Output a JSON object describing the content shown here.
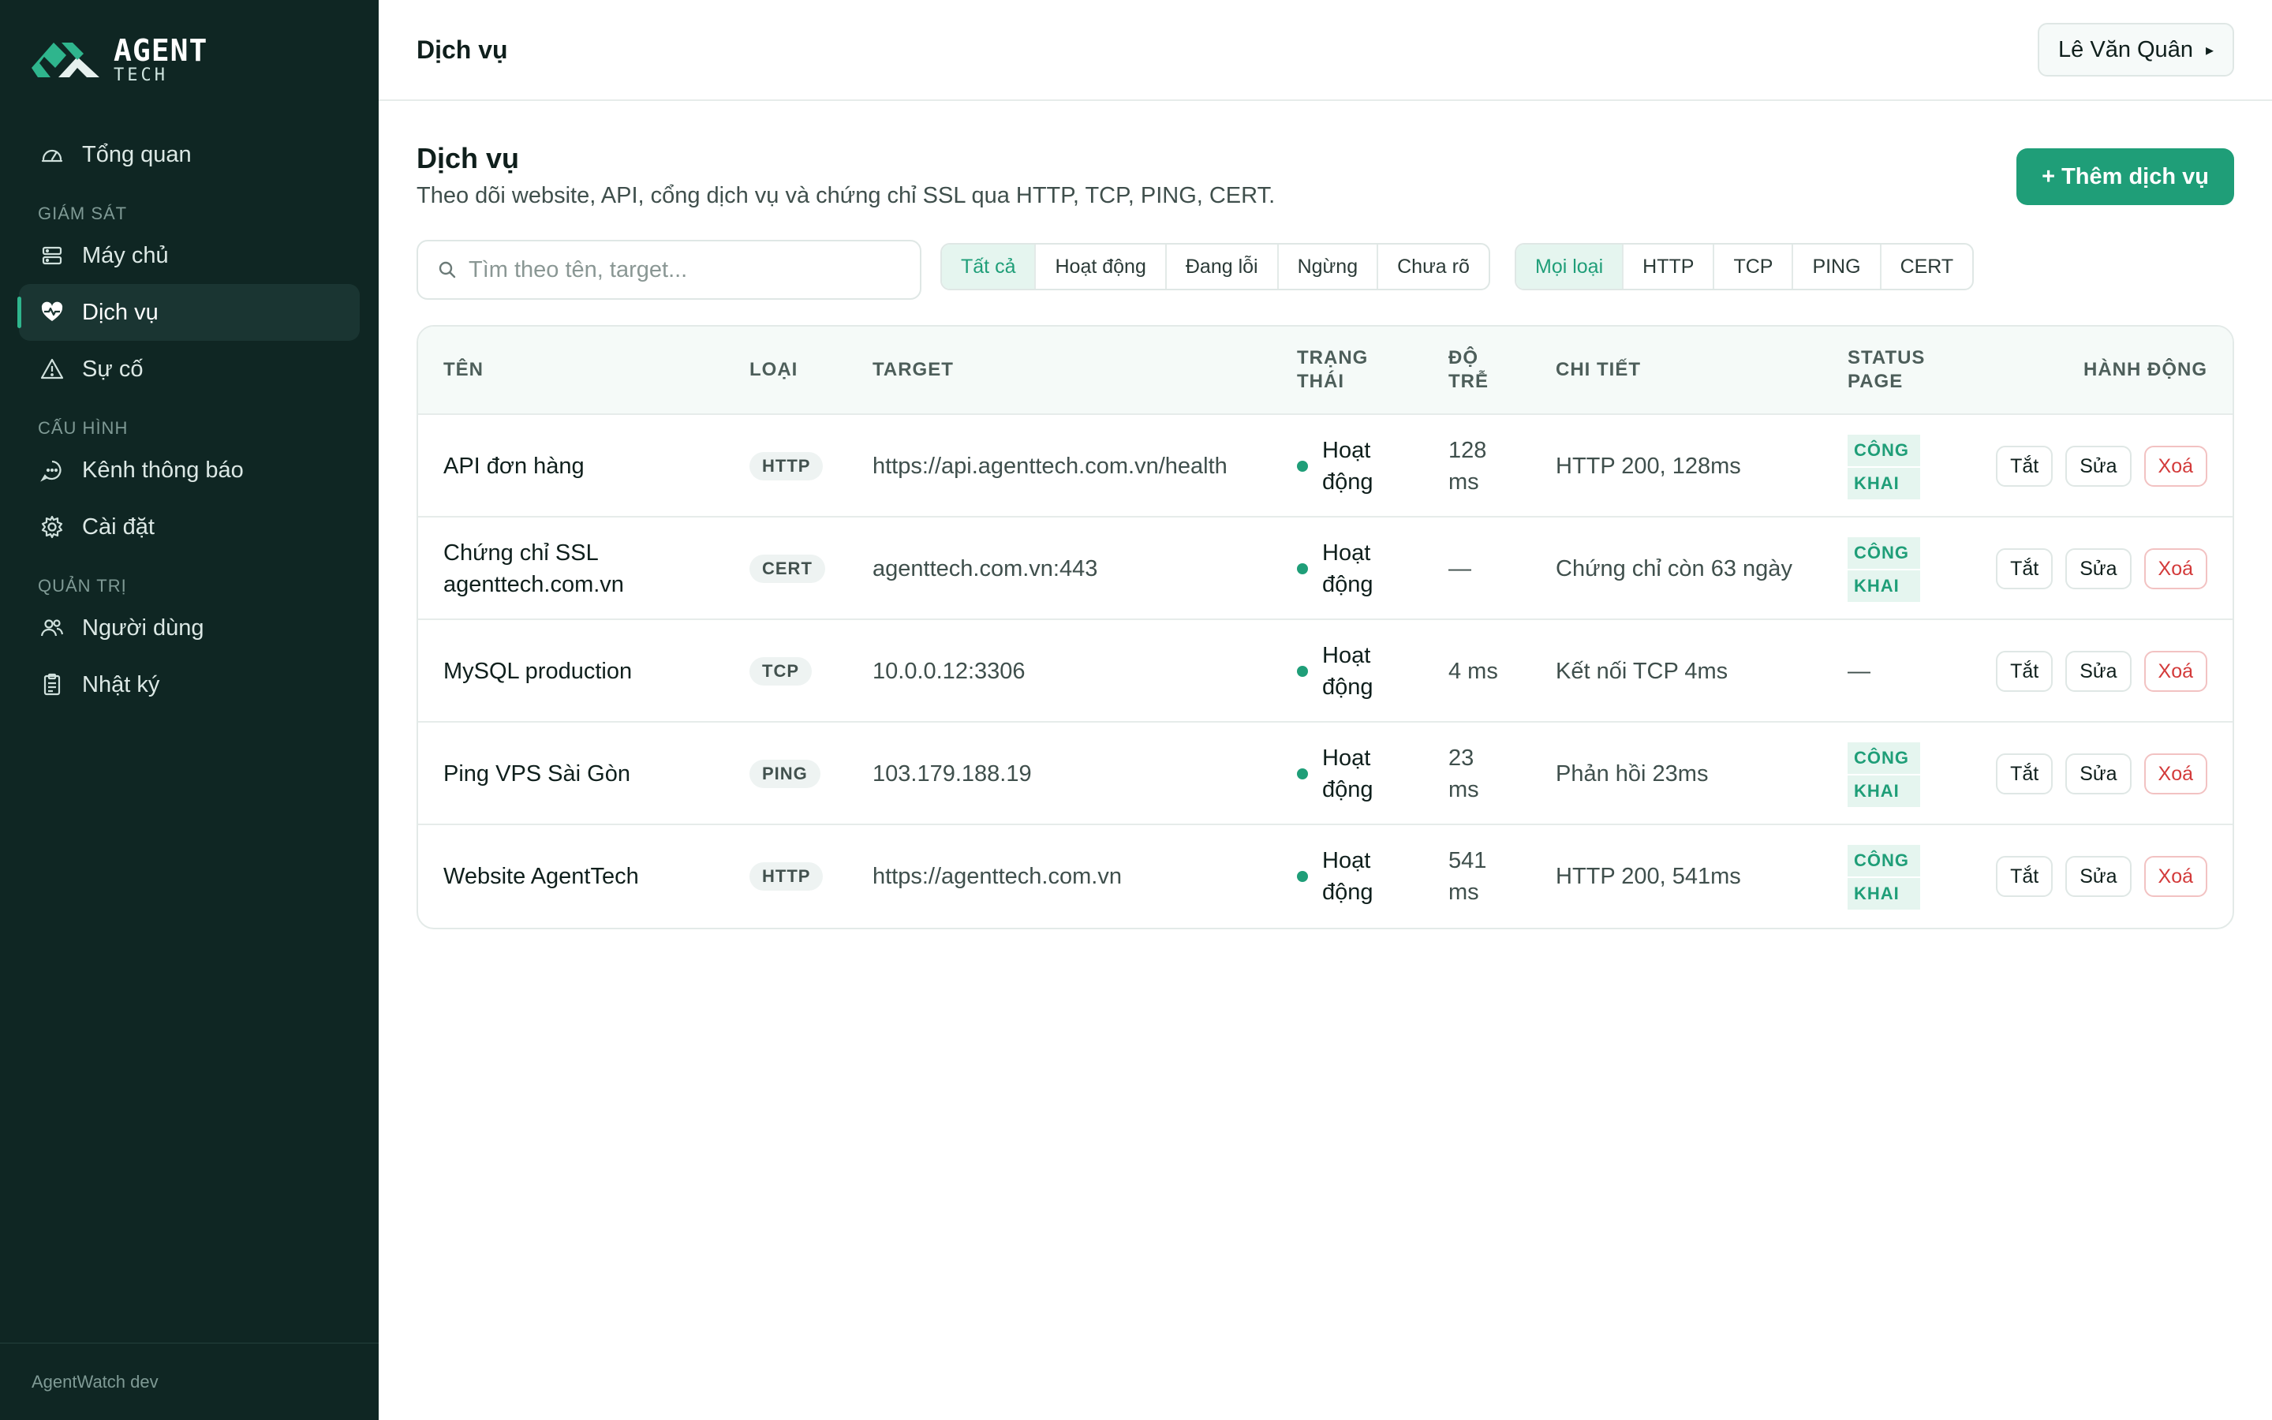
{
  "brand": {
    "line1": "AGENT",
    "line2": "TECH",
    "colors": {
      "accent": "#1f9e78",
      "sidebar_bg": "#0f2623",
      "danger": "#d33a3a"
    }
  },
  "sidebar": {
    "overview": {
      "label": "Tổng quan",
      "icon": "dashboard-icon"
    },
    "sections": [
      {
        "title": "GIÁM SÁT",
        "items": [
          {
            "label": "Máy chủ",
            "icon": "server-icon"
          },
          {
            "label": "Dịch vụ",
            "icon": "heart-pulse-icon",
            "active": true
          },
          {
            "label": "Sự cố",
            "icon": "warning-icon"
          }
        ]
      },
      {
        "title": "CẤU HÌNH",
        "items": [
          {
            "label": "Kênh thông báo",
            "icon": "chat-icon"
          },
          {
            "label": "Cài đặt",
            "icon": "gear-icon"
          }
        ]
      },
      {
        "title": "QUẢN TRỊ",
        "items": [
          {
            "label": "Người dùng",
            "icon": "users-icon"
          },
          {
            "label": "Nhật ký",
            "icon": "clipboard-icon"
          }
        ]
      }
    ],
    "footer": "AgentWatch dev"
  },
  "topbar": {
    "title": "Dịch vụ",
    "user": "Lê Văn Quân",
    "user_arrow": "▸"
  },
  "page": {
    "title": "Dịch vụ",
    "subtitle": "Theo dõi website, API, cổng dịch vụ và chứng chỉ SSL qua HTTP, TCP, PING, CERT.",
    "add_button": "+ Thêm dịch vụ"
  },
  "filters": {
    "search_placeholder": "Tìm theo tên, target...",
    "status_options": [
      "Tất cả",
      "Hoạt động",
      "Đang lỗi",
      "Ngừng",
      "Chưa rõ"
    ],
    "status_selected": "Tất cả",
    "type_options": [
      "Mọi loại",
      "HTTP",
      "TCP",
      "PING",
      "CERT"
    ],
    "type_selected": "Mọi loại"
  },
  "table": {
    "headers": {
      "name": "TÊN",
      "type": "LOẠI",
      "target": "TARGET",
      "status_l1": "TRẠNG",
      "status_l2": "THÁI",
      "latency_l1": "ĐỘ",
      "latency_l2": "TRỄ",
      "detail": "CHI TIẾT",
      "page_l1": "STATUS",
      "page_l2": "PAGE",
      "actions": "HÀNH ĐỘNG"
    },
    "rows": [
      {
        "name_l1": "API đơn hàng",
        "name_l2": "",
        "type": "HTTP",
        "target": "https://api.agenttech.com.vn/health",
        "status_l1": "Hoạt",
        "status_l2": "động",
        "latency_l1": "128",
        "latency_l2": "ms",
        "detail": "HTTP 200, 128ms",
        "page_l1": "CÔNG",
        "page_l2": "KHAI",
        "page_dash": ""
      },
      {
        "name_l1": "Chứng chỉ SSL",
        "name_l2": "agenttech.com.vn",
        "type": "CERT",
        "target": "agenttech.com.vn:443",
        "status_l1": "Hoạt",
        "status_l2": "động",
        "latency_l1": "—",
        "latency_l2": "",
        "detail": "Chứng chỉ còn 63 ngày",
        "page_l1": "CÔNG",
        "page_l2": "KHAI",
        "page_dash": ""
      },
      {
        "name_l1": "MySQL production",
        "name_l2": "",
        "type": "TCP",
        "target": "10.0.0.12:3306",
        "status_l1": "Hoạt",
        "status_l2": "động",
        "latency_l1": "4 ms",
        "latency_l2": "",
        "detail": "Kết nối TCP 4ms",
        "page_l1": "",
        "page_l2": "",
        "page_dash": "—"
      },
      {
        "name_l1": "Ping VPS Sài Gòn",
        "name_l2": "",
        "type": "PING",
        "target": "103.179.188.19",
        "status_l1": "Hoạt",
        "status_l2": "động",
        "latency_l1": "23",
        "latency_l2": "ms",
        "detail": "Phản hồi 23ms",
        "page_l1": "CÔNG",
        "page_l2": "KHAI",
        "page_dash": ""
      },
      {
        "name_l1": "Website AgentTech",
        "name_l2": "",
        "type": "HTTP",
        "target": "https://agenttech.com.vn",
        "status_l1": "Hoạt",
        "status_l2": "động",
        "latency_l1": "541",
        "latency_l2": "ms",
        "detail": "HTTP 200, 541ms",
        "page_l1": "CÔNG",
        "page_l2": "KHAI",
        "page_dash": ""
      }
    ],
    "actions": {
      "toggle": "Tắt",
      "edit": "Sửa",
      "delete": "Xoá"
    }
  }
}
